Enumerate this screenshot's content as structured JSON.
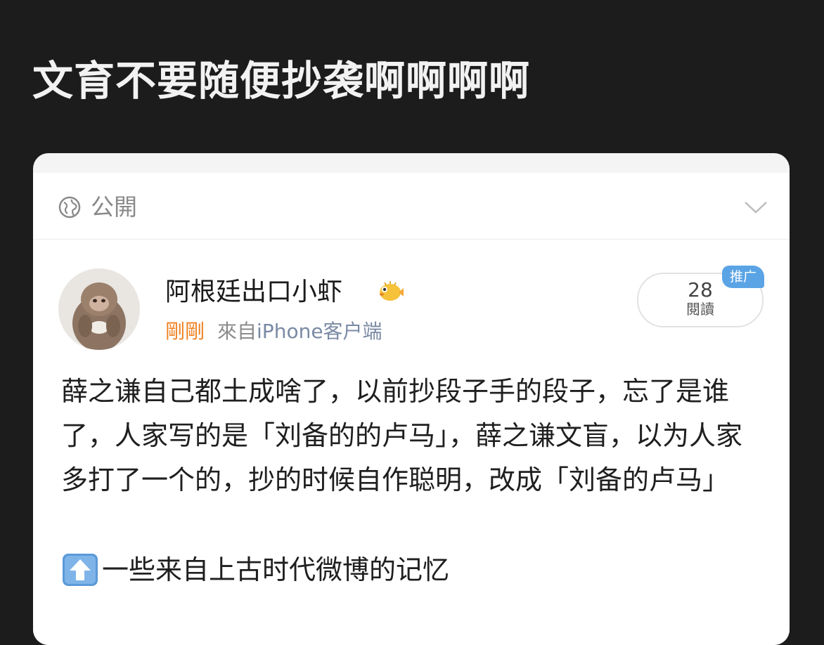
{
  "headline": "文育不要随便抄袭啊啊啊啊",
  "visibility": {
    "label": "公開",
    "icon": "globe-icon"
  },
  "post": {
    "username": "阿根廷出口小虾",
    "user_badge_icon": "pufferfish-emoji-icon",
    "time": "剛剛",
    "source_prefix": "來自",
    "source_device": "iPhone客户端",
    "read_count": "28",
    "read_label": "閱讀",
    "promo_label": "推广",
    "body": "薛之谦自己都土成啥了，以前抄段子手的段子，忘了是谁了，人家写的是「刘备的的卢马」，薛之谦文盲，以为人家多打了一个的，抄的时候自作聪明，改成「刘备的卢马」",
    "footnote": "一些来自上古时代微博的记忆",
    "footnote_icon": "up-arrow-emoji-icon"
  },
  "colors": {
    "background": "#1c1c1c",
    "time_accent": "#f07f1e",
    "promo_badge": "#5aa4e6"
  }
}
